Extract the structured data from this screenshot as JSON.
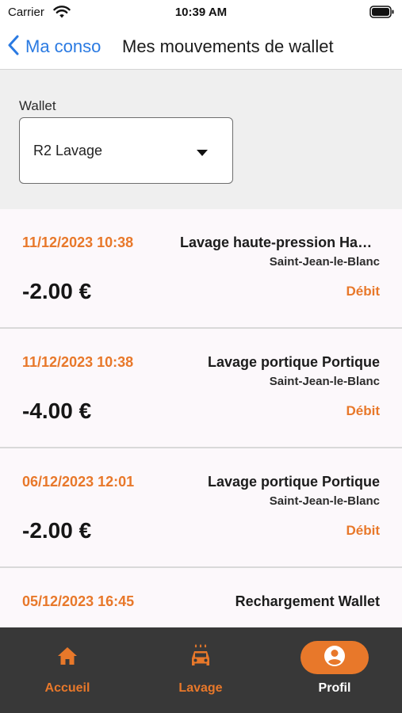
{
  "status_bar": {
    "carrier": "Carrier",
    "time": "10:39 AM",
    "icons": {
      "wifi": "wifi-icon",
      "battery": "battery-icon"
    }
  },
  "nav": {
    "back_label": "Ma conso",
    "title": "Mes mouvements de wallet",
    "back_icon": "chevron-left-icon"
  },
  "wallet": {
    "label": "Wallet",
    "selected": "R2 Lavage",
    "caret_icon": "caret-down-icon"
  },
  "transactions": [
    {
      "date": "11/12/2023 10:38",
      "title": "Lavage haute-pression Haute-pression",
      "location": "Saint-Jean-le-Blanc",
      "amount": "-2.00 €",
      "type": "Débit"
    },
    {
      "date": "11/12/2023 10:38",
      "title": "Lavage portique Portique",
      "location": "Saint-Jean-le-Blanc",
      "amount": "-4.00 €",
      "type": "Débit"
    },
    {
      "date": "06/12/2023 12:01",
      "title": "Lavage portique Portique",
      "location": "Saint-Jean-le-Blanc",
      "amount": "-2.00 €",
      "type": "Débit"
    },
    {
      "date": "05/12/2023 16:45",
      "title": "Rechargement Wallet",
      "location": "",
      "amount": "",
      "type": ""
    }
  ],
  "tabs": [
    {
      "label": "Accueil",
      "icon": "home-icon",
      "active": false
    },
    {
      "label": "Lavage",
      "icon": "car-wash-icon",
      "active": false
    },
    {
      "label": "Profil",
      "icon": "profile-icon",
      "active": true
    }
  ],
  "colors": {
    "accent": "#e8782a",
    "link": "#2a7ae2",
    "tab_bar": "#383838",
    "list_bg": "#fcf8fb",
    "header_bg": "#efefef"
  }
}
